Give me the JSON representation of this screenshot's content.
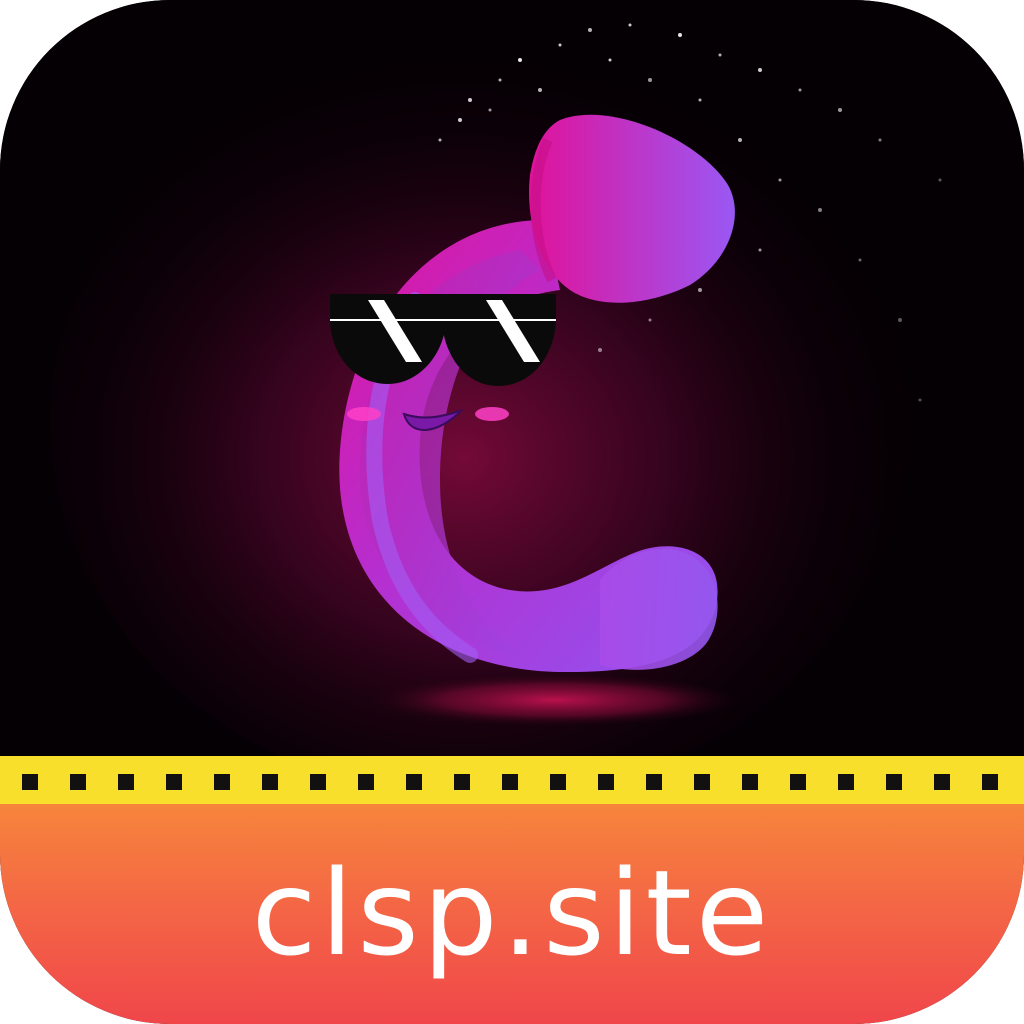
{
  "app_icon": {
    "site_label": "clsp.site",
    "mascot": "cool-c-mascot",
    "colors": {
      "background": "#050004",
      "mascot_pink": "#d2189f",
      "mascot_purple": "#9a4ff0",
      "film_strip": "#f7df2c",
      "banner_top": "#f6853b",
      "banner_bottom": "#f0464a",
      "label_text": "#ffffff"
    }
  }
}
